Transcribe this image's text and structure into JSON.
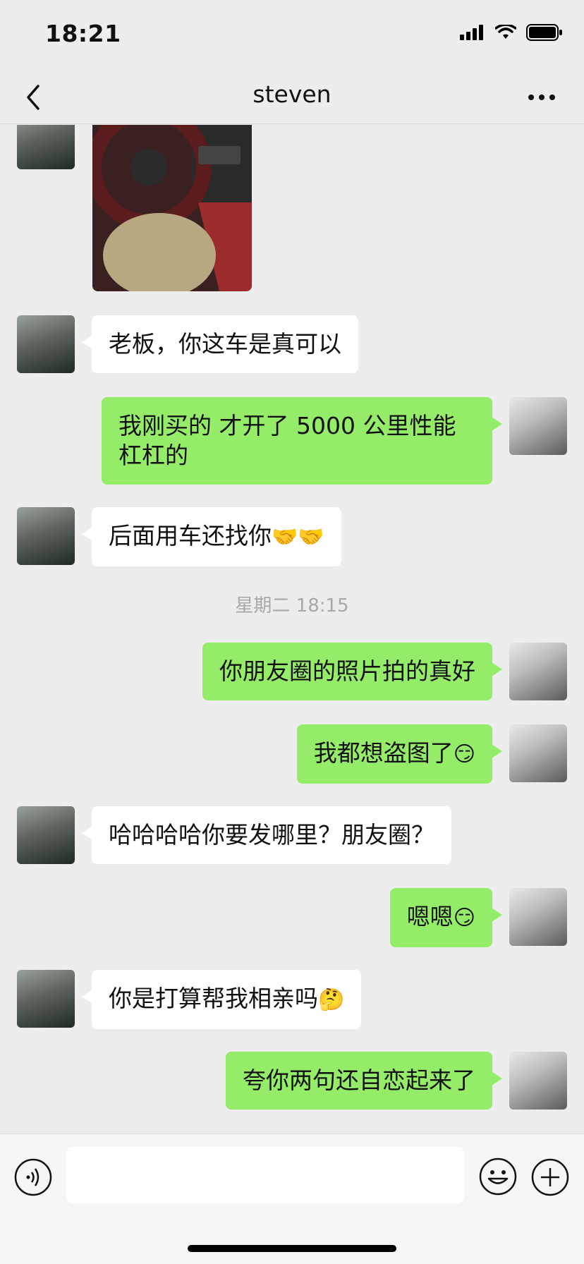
{
  "status_bar": {
    "time": "18:21"
  },
  "nav": {
    "title": "steven",
    "back_icon": "chevron-left-icon",
    "more_icon": "more-icon"
  },
  "messages": [
    {
      "from": "steven",
      "type": "image"
    },
    {
      "from": "steven",
      "text": "老板，你这车是真可以"
    },
    {
      "from": "self",
      "text": "我刚买的 才开了 5000 公里性能杠杠的"
    },
    {
      "from": "steven",
      "text": "后面用车还找你",
      "emoji": "🤝🤝"
    },
    {
      "type": "timestamp",
      "text": "星期二 18:15"
    },
    {
      "from": "self",
      "text": "你朋友圈的照片拍的真好"
    },
    {
      "from": "self",
      "text": "我都想盗图了",
      "emoji": "😏"
    },
    {
      "from": "steven",
      "text": "哈哈哈哈你要发哪里？朋友圈？"
    },
    {
      "from": "self",
      "text": "嗯嗯",
      "emoji": "😏"
    },
    {
      "from": "steven",
      "text": "你是打算帮我相亲吗",
      "emoji": "🤔"
    },
    {
      "from": "self",
      "text": "夸你两句还自恋起来了"
    }
  ],
  "input_bar": {
    "placeholder": ""
  },
  "colors": {
    "self_bubble": "#95ec69",
    "other_bubble": "#ffffff",
    "background": "#ededed"
  }
}
